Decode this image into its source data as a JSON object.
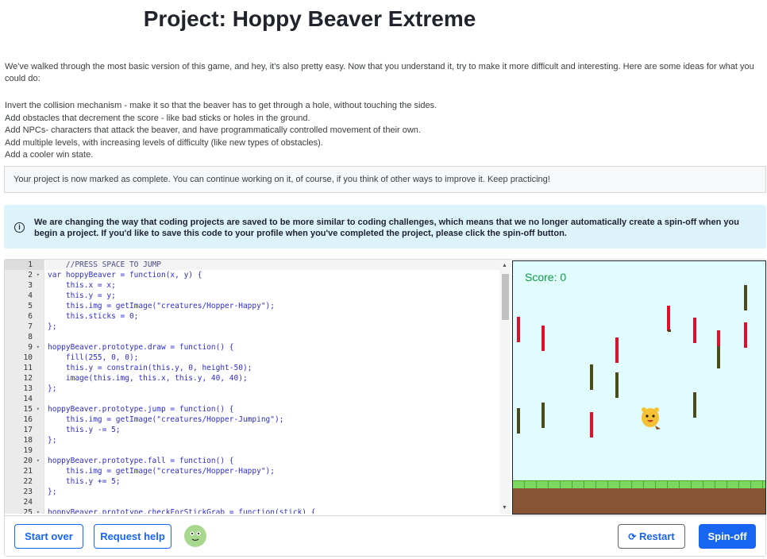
{
  "page": {
    "title": "Project: Hoppy Beaver Extreme",
    "intro": "We've walked through the most basic version of this game, and hey, it's also pretty easy. Now that you understand it, try to make it more difficult and interesting. Here are some ideas for what you could do:",
    "ideas": [
      "Invert the collision mechanism - make it so that the beaver has to get through a hole, without touching the sides.",
      "Add obstacles that decrement the score - like bad sticks or holes in the ground.",
      "Add NPCs- characters that attack the beaver, and have programmatically controlled movement of their own.",
      "Add multiple levels, with increasing levels of difficulty (like new types of obstacles).",
      "Add a cooler win state."
    ],
    "complete_message": "Your project is now marked as complete. You can continue working on it, of course, if you think of other ways to improve it. Keep practicing!",
    "info_message": "We are changing the way that coding projects are saved to be more similar to coding challenges, which means that we no longer automatically create a spin-off when you begin a project. If you'd like to save this code to your profile when you've completed the project, please click the spin-off button."
  },
  "editor": {
    "line_numbers": [
      "1",
      "2",
      "3",
      "4",
      "5",
      "6",
      "7",
      "8",
      "9",
      "10",
      "11",
      "12",
      "13",
      "14",
      "15",
      "16",
      "17",
      "18",
      "19",
      "20",
      "21",
      "22",
      "23",
      "24",
      "25"
    ],
    "fold_lines": [
      "2",
      "9",
      "15",
      "20",
      "25"
    ],
    "lines": [
      "    //PRESS SPACE TO JUMP",
      "var hoppyBeaver = function(x, y) {",
      "    this.x = x;",
      "    this.y = y;",
      "    this.img = getImage(\"creatures/Hopper-Happy\");",
      "    this.sticks = 0;",
      "};",
      "",
      "hoppyBeaver.prototype.draw = function() {",
      "    fill(255, 0, 0);",
      "    this.y = constrain(this.y, 0, height-50);",
      "    image(this.img, this.x, this.y, 40, 40);",
      "};",
      "",
      "hoppyBeaver.prototype.jump = function() {",
      "    this.img = getImage(\"creatures/Hopper-Jumping\");",
      "    this.y -= 5;",
      "};",
      "",
      "hoppyBeaver.prototype.fall = function() {",
      "    this.img = getImage(\"creatures/Hopper-Happy\");",
      "    this.y += 5;",
      "};",
      "",
      "hoppyBeaver.prototype.checkForStickGrab = function(stick) {"
    ]
  },
  "canvas": {
    "score_text": "Score: 0",
    "colors": {
      "sky": "#e0fcff",
      "red_stick": "#e0102a",
      "brown_stick": "#4d4a1a",
      "grass": "#7dd860",
      "dirt": "#875434"
    }
  },
  "bottombar": {
    "start_over": "Start over",
    "request_help": "Request help",
    "restart": "Restart",
    "spin_off": "Spin-off"
  }
}
